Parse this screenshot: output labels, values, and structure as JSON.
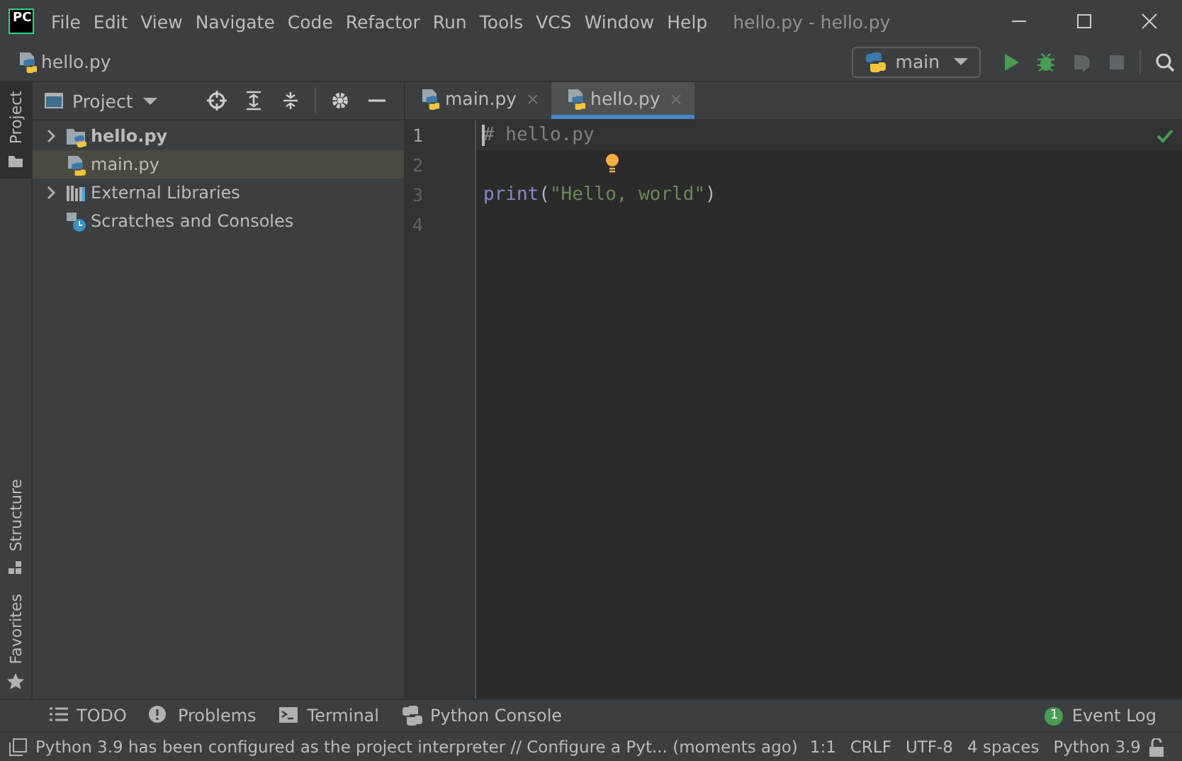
{
  "window": {
    "logo": "PC",
    "title": "hello.py - hello.py"
  },
  "menu": [
    {
      "label": "File"
    },
    {
      "label": "Edit"
    },
    {
      "label": "View"
    },
    {
      "label": "Navigate"
    },
    {
      "label": "Code"
    },
    {
      "label": "Refactor"
    },
    {
      "label": "Run"
    },
    {
      "label": "Tools"
    },
    {
      "label": "VCS"
    },
    {
      "label": "Window"
    },
    {
      "label": "Help"
    }
  ],
  "navbar": {
    "breadcrumb": "hello.py",
    "run_config": "main"
  },
  "left_strip": [
    {
      "label": "Project",
      "selected": true,
      "kind": "project"
    },
    {
      "label": "Structure",
      "selected": false,
      "kind": "structure"
    },
    {
      "label": "Favorites",
      "selected": false,
      "kind": "favorites"
    }
  ],
  "project_panel": {
    "title": "Project",
    "tree": [
      {
        "label": "hello.py",
        "kind": "folder",
        "expanded": false,
        "bold": true,
        "selected": false
      },
      {
        "label": "main.py",
        "kind": "file",
        "bold": false,
        "selected": true
      },
      {
        "label": "External Libraries",
        "kind": "libraries",
        "expanded": false,
        "bold": false,
        "selected": false
      },
      {
        "label": "Scratches and Consoles",
        "kind": "scratches",
        "bold": false,
        "selected": false
      }
    ]
  },
  "editor": {
    "tabs": [
      {
        "label": "main.py",
        "selected": false
      },
      {
        "label": "hello.py",
        "selected": true
      }
    ],
    "lines": [
      {
        "number": "1",
        "current": true,
        "tokens": [
          {
            "kind": "comment",
            "text": "# hello.py"
          }
        ]
      },
      {
        "number": "2",
        "current": false
      },
      {
        "number": "3",
        "current": false,
        "tokens": [
          {
            "kind": "builtin",
            "text": "print"
          },
          {
            "kind": "plain",
            "text": "("
          },
          {
            "kind": "string",
            "text": "\"Hello, world\""
          },
          {
            "kind": "plain",
            "text": ")"
          }
        ]
      },
      {
        "number": "4",
        "current": false
      }
    ]
  },
  "tool_windows": [
    {
      "label": "TODO",
      "kind": "todo"
    },
    {
      "label": "Problems",
      "kind": "problems"
    },
    {
      "label": "Terminal",
      "kind": "terminal"
    },
    {
      "label": "Python Console",
      "kind": "python"
    }
  ],
  "event_log": {
    "label": "Event Log",
    "count": "1"
  },
  "status_bar": {
    "message": "Python 3.9 has been configured as the project interpreter // Configure a Pyt... (moments ago)",
    "items": [
      "1:1",
      "CRLF",
      "UTF-8",
      "4 spaces",
      "Python 3.9"
    ]
  }
}
